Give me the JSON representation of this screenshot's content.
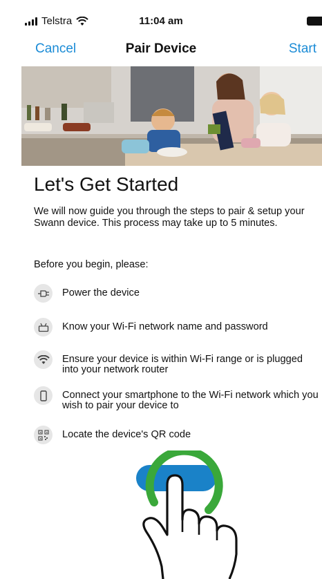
{
  "status_bar": {
    "carrier": "Telstra",
    "time": "11:04 am",
    "icons": [
      "signal-icon",
      "wifi-icon",
      "battery-icon"
    ]
  },
  "nav": {
    "cancel_label": "Cancel",
    "title": "Pair Device",
    "start_label": "Start"
  },
  "content": {
    "heading": "Let's Get Started",
    "intro": "We will now guide you through the steps to pair & setup your Swann device. This process may take up to 5 minutes.",
    "before_label": "Before you begin, please:",
    "checklist": [
      {
        "icon": "power-plug-icon",
        "text": "Power the device"
      },
      {
        "icon": "router-icon",
        "text": "Know your Wi-Fi network name and password"
      },
      {
        "icon": "wifi-icon",
        "text": "Ensure your device is within Wi-Fi range or is plugged into your network router"
      },
      {
        "icon": "smartphone-icon",
        "text": "Connect your smartphone to the Wi-Fi network which you wish to pair your device to"
      },
      {
        "icon": "qr-code-icon",
        "text": "Locate the device's QR code"
      }
    ]
  },
  "colors": {
    "accent": "#1a8bd6",
    "button": "#1a82c8",
    "tap_ring": "#3aa83a",
    "icon_bg": "#e6e6e6"
  },
  "overlay": {
    "type": "tap-gesture",
    "icons": [
      "tap-ring-icon",
      "pointing-hand-icon"
    ]
  }
}
